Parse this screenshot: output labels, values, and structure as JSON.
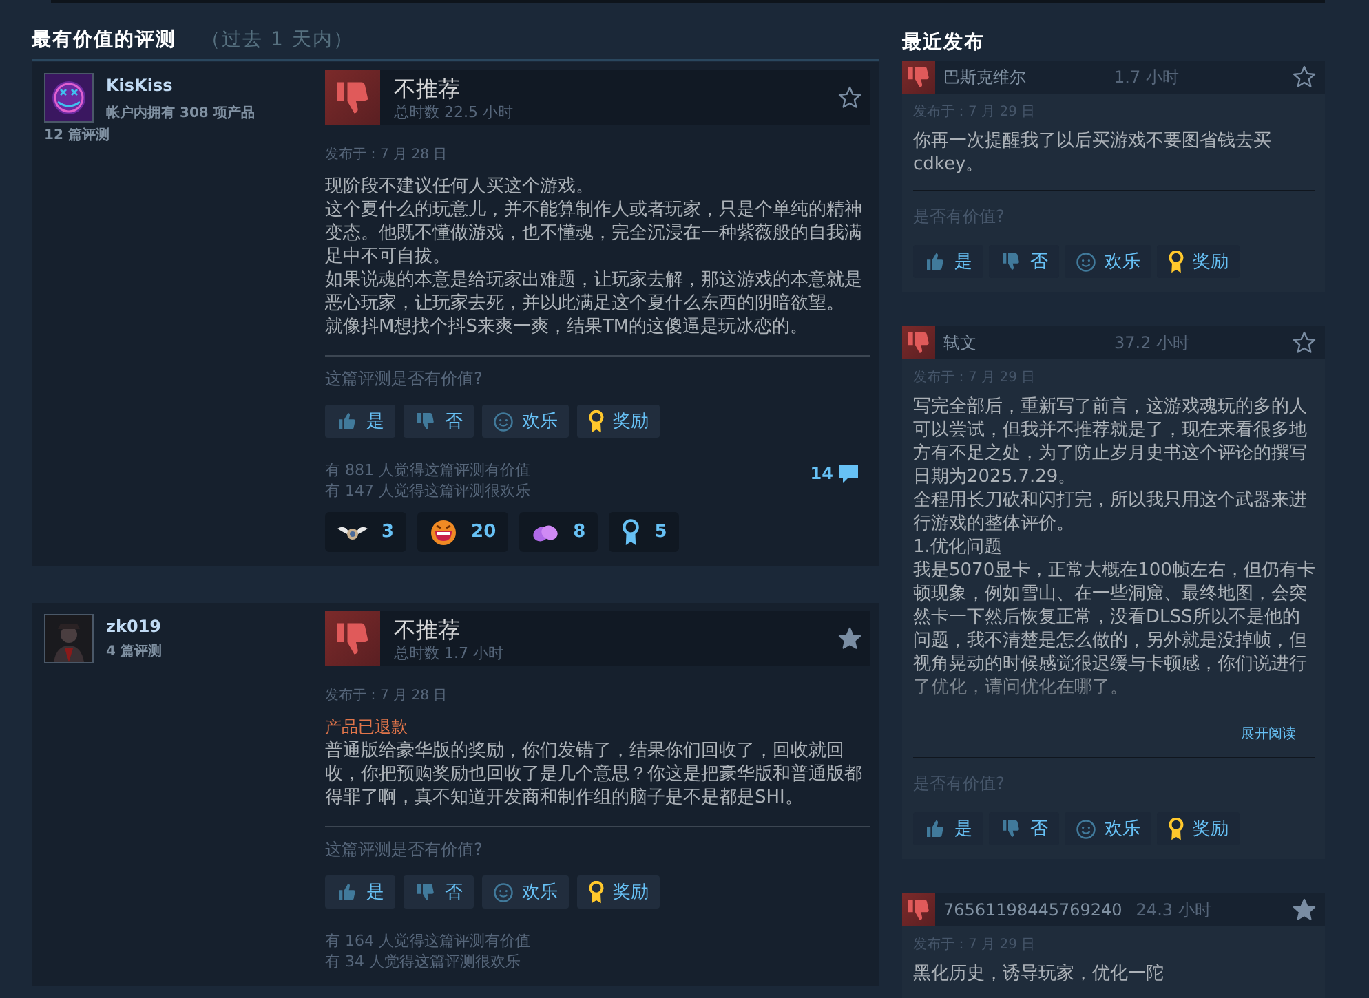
{
  "header": {
    "title": "最有价值的评测",
    "subtitle": "（过去 1 天内）"
  },
  "reviews": [
    {
      "author": {
        "name": "KisKiss",
        "products": "帐户内拥有 308 项产品",
        "review_count": "12 篇评测"
      },
      "recommended": false,
      "verdict": "不推荐",
      "playtime": "总时数 22.5 小时",
      "awarded": false,
      "posted": "发布于：7 月 28 日",
      "text": [
        "现阶段不建议任何人买这个游戏。",
        "这个夏什么的玩意儿，并不能算制作人或者玩家，只是个单纯的精神变态。他既不懂做游戏，也不懂魂，完全沉浸在一种紫薇般的自我满足中不可自拔。",
        "如果说魂的本意是给玩家出难题，让玩家去解，那这游戏的本意就是恶心玩家，让玩家去死，并以此满足这个夏什么东西的阴暗欲望。",
        "就像抖M想找个抖S来爽一爽，结果TM的这傻逼是玩冰恋的。"
      ],
      "prompt": "这篇评测是否有价值?",
      "buttons": [
        {
          "kind": "yes",
          "label": "是"
        },
        {
          "kind": "no",
          "label": "否"
        },
        {
          "kind": "funny",
          "label": "欢乐"
        },
        {
          "kind": "award",
          "label": "奖励"
        }
      ],
      "helpful": "有 881 人觉得这篇评测有价值",
      "funny": "有 147 人觉得这篇评测很欢乐",
      "comments": "14",
      "reactions": [
        {
          "kind": "wings",
          "count": "3"
        },
        {
          "kind": "laugh",
          "count": "20"
        },
        {
          "kind": "hands",
          "count": "8"
        },
        {
          "kind": "ribbon",
          "count": "5"
        }
      ]
    },
    {
      "author": {
        "name": "zk019",
        "review_count": "4 篇评测"
      },
      "recommended": false,
      "verdict": "不推荐",
      "playtime": "总时数 1.7 小时",
      "awarded": true,
      "posted": "发布于：7 月 28 日",
      "note": "产品已退款",
      "text": [
        "普通版给豪华版的奖励，你们发错了，结果你们回收了，回收就回收，你把预购奖励也回收了是几个意思？你这是把豪华版和普通版都得罪了啊，真不知道开发商和制作组的脑子是不是都是SHI。"
      ],
      "prompt": "这篇评测是否有价值?",
      "buttons": [
        {
          "kind": "yes",
          "label": "是"
        },
        {
          "kind": "no",
          "label": "否"
        },
        {
          "kind": "funny",
          "label": "欢乐"
        },
        {
          "kind": "award",
          "label": "奖励"
        }
      ],
      "helpful": "有 164 人觉得这篇评测有价值",
      "funny": "有 34 人觉得这篇评测很欢乐"
    }
  ],
  "recent": {
    "title": "最近发布",
    "reviews": [
      {
        "author": "巴斯克维尔",
        "recommended": false,
        "playtime": "1.7 小时",
        "awarded": false,
        "posted": "发布于：7 月 29 日",
        "text": [
          "你再一次提醒我了以后买游戏不要图省钱去买cdkey。"
        ],
        "truncated": false,
        "prompt": "是否有价值?",
        "buttons": [
          {
            "kind": "yes",
            "label": "是"
          },
          {
            "kind": "no",
            "label": "否"
          },
          {
            "kind": "funny",
            "label": "欢乐"
          },
          {
            "kind": "award",
            "label": "奖励"
          }
        ]
      },
      {
        "author": "轼文",
        "recommended": false,
        "playtime": "37.2 小时",
        "awarded": false,
        "posted": "发布于：7 月 29 日",
        "text": [
          "写完全部后，重新写了前言，这游戏魂玩的多的人可以尝试，但我并不推荐就是了，现在来看很多地方有不足之处，为了防止岁月史书这个评论的撰写日期为2025.7.29。",
          "全程用长刀砍和闪打完，所以我只用这个武器来进行游戏的整体评价。",
          "1.优化问题",
          "我是5070显卡，正常大概在100帧左右，但仍有卡顿现象，例如雪山、在一些洞窟、最终地图，会突然卡一下然后恢复正常，没看DLSS所以不是他的问题，我不清楚是怎么做的，另外就是没掉帧，但视角晃动的时候感觉很迟缓与卡顿感，你们说进行了优化，请问优化在哪了。"
        ],
        "truncated": true,
        "expand": "展开阅读",
        "prompt": "是否有价值?",
        "buttons": [
          {
            "kind": "yes",
            "label": "是"
          },
          {
            "kind": "no",
            "label": "否"
          },
          {
            "kind": "funny",
            "label": "欢乐"
          },
          {
            "kind": "award",
            "label": "奖励"
          }
        ]
      },
      {
        "author": "76561198445769240",
        "recommended": false,
        "playtime": "24.3 小时",
        "awarded": true,
        "posted": "发布于：7 月 29 日",
        "text": [
          "黑化历史，诱导玩家，优化一陀"
        ],
        "truncated": false
      }
    ]
  }
}
